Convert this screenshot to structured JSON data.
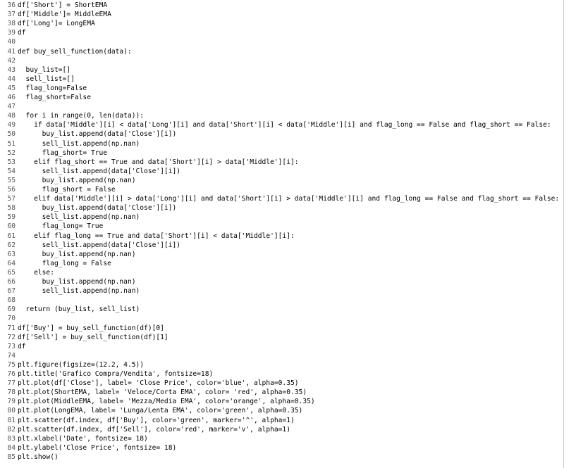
{
  "editor": {
    "lines": [
      {
        "n": "36",
        "t": "df['Short'] = ShortEMA"
      },
      {
        "n": "37",
        "t": "df['Middle']= MiddleEMA"
      },
      {
        "n": "38",
        "t": "df['Long']= LongEMA"
      },
      {
        "n": "39",
        "t": "df"
      },
      {
        "n": "40",
        "t": ""
      },
      {
        "n": "41",
        "t": "def buy_sell_function(data):"
      },
      {
        "n": "42",
        "t": ""
      },
      {
        "n": "43",
        "t": "  buy_list=[]"
      },
      {
        "n": "44",
        "t": "  sell_list=[]"
      },
      {
        "n": "45",
        "t": "  flag_long=False"
      },
      {
        "n": "46",
        "t": "  flag_short=False"
      },
      {
        "n": "47",
        "t": ""
      },
      {
        "n": "48",
        "t": "  for i in range(0, len(data)):"
      },
      {
        "n": "49",
        "t": "    if data['Middle'][i] < data['Long'][i] and data['Short'][i] < data['Middle'][i] and flag_long == False and flag_short == False:"
      },
      {
        "n": "50",
        "t": "      buy_list.append(data['Close'][i])"
      },
      {
        "n": "51",
        "t": "      sell_list.append(np.nan)"
      },
      {
        "n": "52",
        "t": "      flag_short= True"
      },
      {
        "n": "53",
        "t": "    elif flag_short == True and data['Short'][i] > data['Middle'][i]:"
      },
      {
        "n": "54",
        "t": "      sell_list.append(data['Close'][i])"
      },
      {
        "n": "55",
        "t": "      buy_list.append(np.nan)"
      },
      {
        "n": "56",
        "t": "      flag_short = False"
      },
      {
        "n": "57",
        "t": "    elif data['Middle'][i] > data['Long'][i] and data['Short'][i] > data['Middle'][i] and flag_long == False and flag_short == False:"
      },
      {
        "n": "58",
        "t": "      buy_list.append(data['Close'][i])"
      },
      {
        "n": "59",
        "t": "      sell_list.append(np.nan)"
      },
      {
        "n": "60",
        "t": "      flag_long= True"
      },
      {
        "n": "61",
        "t": "    elif flag_long == True and data['Short'][i] < data['Middle'][i]:"
      },
      {
        "n": "62",
        "t": "      sell_list.append(data['Close'][i])"
      },
      {
        "n": "63",
        "t": "      buy_list.append(np.nan)"
      },
      {
        "n": "64",
        "t": "      flag_long = False"
      },
      {
        "n": "65",
        "t": "    else:"
      },
      {
        "n": "66",
        "t": "      buy_list.append(np.nan)"
      },
      {
        "n": "67",
        "t": "      sell_list.append(np.nan)"
      },
      {
        "n": "68",
        "t": ""
      },
      {
        "n": "69",
        "t": "  return (buy_list, sell_list)"
      },
      {
        "n": "70",
        "t": ""
      },
      {
        "n": "71",
        "t": "df['Buy'] = buy_sell_function(df)[0]"
      },
      {
        "n": "72",
        "t": "df['Sell'] = buy_sell_function(df)[1]"
      },
      {
        "n": "73",
        "t": "df"
      },
      {
        "n": "74",
        "t": ""
      },
      {
        "n": "75",
        "t": "plt.figure(figsize=(12.2, 4.5))"
      },
      {
        "n": "76",
        "t": "plt.title('Grafico Compra/Vendita', fontsize=18)"
      },
      {
        "n": "77",
        "t": "plt.plot(df['Close'], label= 'Close Price', color='blue', alpha=0.35)"
      },
      {
        "n": "78",
        "t": "plt.plot(ShortEMA, label= 'Veloce/Corta EMA', color= 'red', alpha=0.35)"
      },
      {
        "n": "79",
        "t": "plt.plot(MiddleEMA, label= 'Mezza/Media EMA', color='orange', alpha=0.35)"
      },
      {
        "n": "80",
        "t": "plt.plot(LongEMA, label= 'Lunga/Lenta EMA', color='green', alpha=0.35)"
      },
      {
        "n": "81",
        "t": "plt.scatter(df.index, df['Buy'], color='green', marker='^', alpha=1)"
      },
      {
        "n": "82",
        "t": "plt.scatter(df.index, df['Sell'], color='red', marker='v', alpha=1)"
      },
      {
        "n": "83",
        "t": "plt.xlabel('Date', fontsize= 18)"
      },
      {
        "n": "84",
        "t": "plt.ylabel('Close Price', fontsize= 18)"
      },
      {
        "n": "85",
        "t": "plt.show()"
      }
    ]
  }
}
